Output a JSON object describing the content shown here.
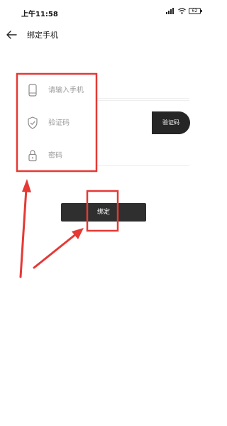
{
  "status_bar": {
    "time": "上午11:58",
    "battery": "62"
  },
  "nav": {
    "title": "绑定手机",
    "back_icon": "arrow-left-icon"
  },
  "form": {
    "phone_placeholder": "请输入手机",
    "code_placeholder": "验证码",
    "password_placeholder": "密码",
    "phone_icon": "phone-icon",
    "code_icon": "shield-check-icon",
    "password_icon": "lock-icon",
    "send_code_label": "验证码"
  },
  "bind_button": {
    "label": "绑定"
  },
  "annotation": {
    "color": "#e53935"
  },
  "colors": {
    "button_bg": "#2f2f2f",
    "placeholder": "#9a9a9a"
  }
}
